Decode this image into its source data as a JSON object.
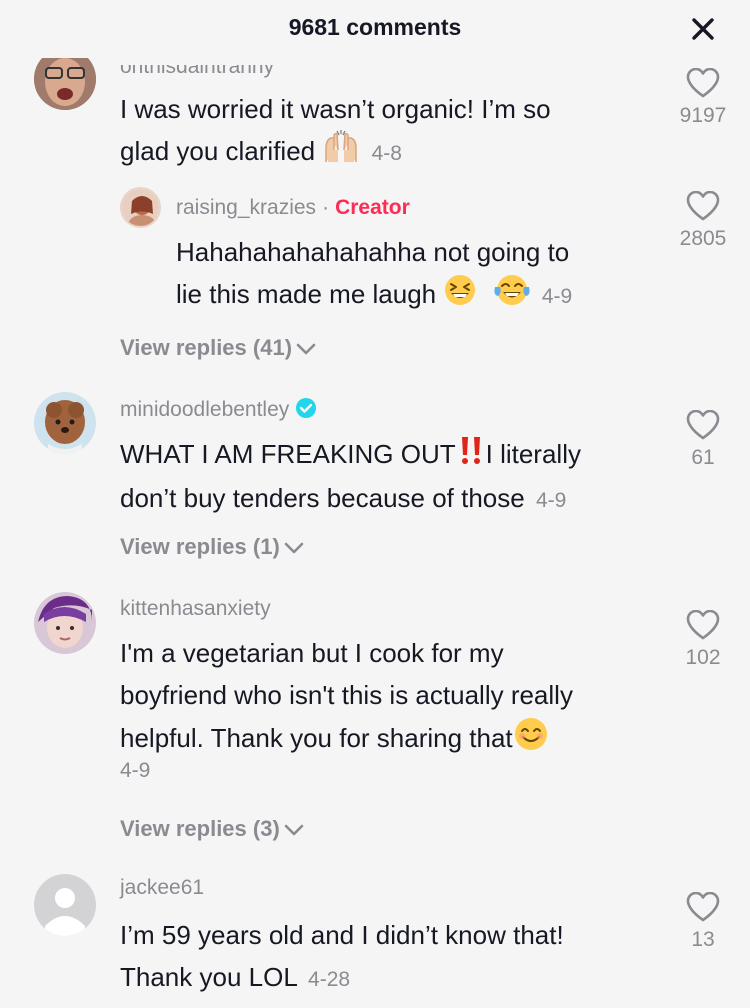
{
  "header": {
    "comment_count": "9681",
    "comments_label": "comments",
    "close_icon": "close-icon"
  },
  "comments": [
    {
      "username": "onthisdaintranny",
      "text": "I was worried it wasn’t organic! I’m so glad you clarified",
      "text_line1": "I was worried it wasn’t organic! I’m so",
      "text_line2": "glad you clarified",
      "emoji": "raising-hands-emoji",
      "date": "4-8",
      "likes": "9197",
      "reply": {
        "username": "raising_krazies",
        "separator": "·",
        "badge": "Creator",
        "text_line1": "Hahahahahahahahha not going to",
        "text_line2": "lie this made me laugh",
        "emojis": [
          "grinning-squinting-emoji",
          "tears-of-joy-emoji"
        ],
        "date": "4-9",
        "likes": "2805"
      },
      "view_replies": "View replies (41)"
    },
    {
      "username": "minidoodlebentley",
      "verified": true,
      "text_line1a": "WHAT I AM FREAKING OUT",
      "text_line1b": "I literally",
      "text_line2": "don’t buy tenders because of those",
      "emoji": "double-exclamation-emoji",
      "date": "4-9",
      "likes": "61",
      "view_replies": "View replies (1)"
    },
    {
      "username": "kittenhasanxiety",
      "text_line1": "I'm a vegetarian but I cook for my",
      "text_line2": "boyfriend who isn't this is actually really",
      "text_line3": "helpful. Thank you for sharing that",
      "emoji": "smiling-face-emoji",
      "date": "4-9",
      "likes": "102",
      "view_replies": "View replies (3)"
    },
    {
      "username": "jackee61",
      "text_line1": "I’m 59 years old and I didn’t know that!",
      "text_line2": "Thank you LOL",
      "date": "4-28",
      "likes": "13"
    }
  ],
  "colors": {
    "background": "#f5f5f5",
    "text": "#161823",
    "muted": "#8a8b91",
    "creator": "#fe2c55",
    "verified": "#20d5ec"
  }
}
